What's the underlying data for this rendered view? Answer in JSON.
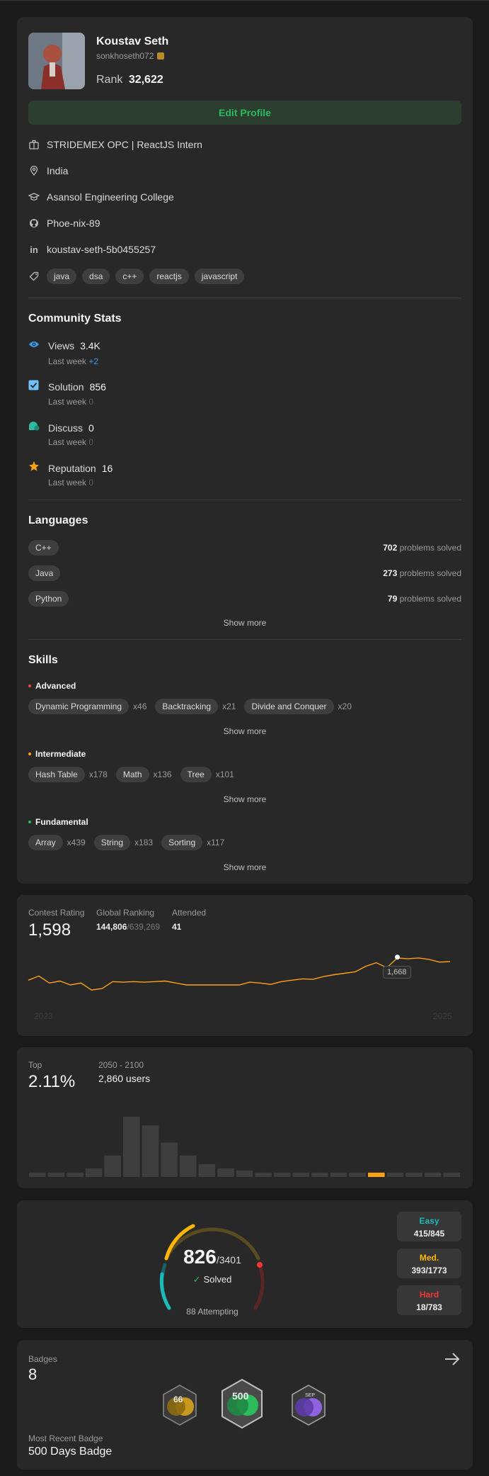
{
  "profile": {
    "name": "Koustav Seth",
    "username": "sonkhoseth072",
    "rank_label": "Rank",
    "rank_value": "32,622",
    "edit_button": "Edit Profile",
    "company": "STRIDEMEX OPC | ReactJS Intern",
    "location": "India",
    "school": "Asansol Engineering College",
    "github": "Phoe-nix-89",
    "linkedin": "koustav-seth-5b0455257",
    "tags": [
      "java",
      "dsa",
      "c++",
      "reactjs",
      "javascript"
    ]
  },
  "community": {
    "title": "Community Stats",
    "last_week_label": "Last week",
    "stats": [
      {
        "label": "Views",
        "value": "3.4K",
        "delta": "+2",
        "icon": "eye-icon",
        "color": "#3b9cf0"
      },
      {
        "label": "Solution",
        "value": "856",
        "delta": "0",
        "icon": "check-square-icon",
        "color": "#6fc1f7"
      },
      {
        "label": "Discuss",
        "value": "0",
        "delta": "0",
        "icon": "discuss-bubble-icon",
        "color": "#2cbb9e"
      },
      {
        "label": "Reputation",
        "value": "16",
        "delta": "0",
        "icon": "star-icon",
        "color": "#ffa116"
      }
    ]
  },
  "languages": {
    "title": "Languages",
    "suffix": "problems solved",
    "items": [
      {
        "name": "C++",
        "count": "702"
      },
      {
        "name": "Java",
        "count": "273"
      },
      {
        "name": "Python",
        "count": "79"
      }
    ],
    "show_more": "Show more"
  },
  "skills": {
    "title": "Skills",
    "show_more": "Show more",
    "levels": [
      {
        "name": "Advanced",
        "color": "#ef4743",
        "items": [
          {
            "name": "Dynamic Programming",
            "count": "x46"
          },
          {
            "name": "Backtracking",
            "count": "x21"
          },
          {
            "name": "Divide and Conquer",
            "count": "x20"
          }
        ]
      },
      {
        "name": "Intermediate",
        "color": "#ffa116",
        "items": [
          {
            "name": "Hash Table",
            "count": "x178"
          },
          {
            "name": "Math",
            "count": "x136"
          },
          {
            "name": "Tree",
            "count": "x101"
          }
        ]
      },
      {
        "name": "Fundamental",
        "color": "#2cbb5d",
        "items": [
          {
            "name": "Array",
            "count": "x439"
          },
          {
            "name": "String",
            "count": "x183"
          },
          {
            "name": "Sorting",
            "count": "x117"
          }
        ]
      }
    ]
  },
  "contest": {
    "rating_label": "Contest Rating",
    "rating": "1,598",
    "global_label": "Global Ranking",
    "global_rank": "144,806",
    "global_total": "/639,269",
    "attended_label": "Attended",
    "attended": "41",
    "tooltip": "1,668",
    "year_start": "2023",
    "year_end": "2025",
    "line_color": "#ffa116"
  },
  "chart_data": {
    "type": "line",
    "title": "",
    "xlabel": "",
    "ylabel": "",
    "x": [
      1,
      2,
      3,
      4,
      5,
      6,
      7,
      8,
      9,
      10,
      11,
      12,
      13,
      14,
      15,
      16,
      17,
      18,
      19,
      20,
      21,
      22,
      23,
      24,
      25,
      26,
      27,
      28,
      29,
      30,
      31,
      32,
      33,
      34,
      35,
      36,
      37,
      38,
      39,
      40,
      41
    ],
    "values": [
      1585,
      1600,
      1575,
      1582,
      1568,
      1575,
      1550,
      1555,
      1580,
      1578,
      1580,
      1578,
      1580,
      1582,
      1575,
      1568,
      1568,
      1568,
      1568,
      1568,
      1568,
      1578,
      1575,
      1570,
      1580,
      1585,
      1590,
      1588,
      1598,
      1605,
      1610,
      1615,
      1635,
      1648,
      1630,
      1665,
      1662,
      1665,
      1660,
      1650,
      1652
    ],
    "highlight": {
      "x": 36,
      "value": 1668
    },
    "x_tick_labels": [
      "2023",
      "2025"
    ]
  },
  "top_percent": {
    "label": "Top",
    "value": "2.11%",
    "range": "2050 - 2100",
    "users": "2,860 users",
    "bars": [
      1,
      1,
      1,
      2,
      5,
      14,
      12,
      8,
      5,
      3,
      2,
      1.5,
      1,
      1,
      1,
      1,
      1,
      1,
      1,
      1,
      1,
      1,
      1
    ],
    "highlight_index": 18,
    "bar_color": "#3e3e3e",
    "highlight_color": "#ffa116"
  },
  "solved": {
    "count": "826",
    "total": "/3401",
    "check": "✓",
    "label": "Solved",
    "attempting": "88 Attempting",
    "easy_label": "Easy",
    "easy": "415/845",
    "easy_color": "#1cbaba",
    "med_label": "Med.",
    "med": "393/1773",
    "med_color": "#ffb700",
    "hard_label": "Hard",
    "hard": "18/783",
    "hard_color": "#f63737"
  },
  "badges": {
    "label": "Badges",
    "count": "8",
    "recent_label": "Most Recent Badge",
    "recent_name": "500 Days Badge"
  }
}
